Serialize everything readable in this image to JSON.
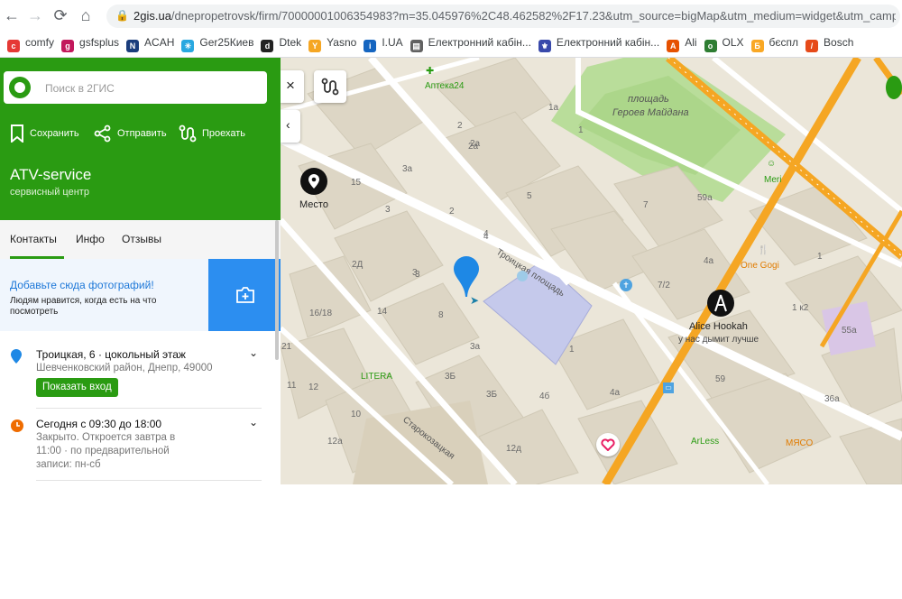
{
  "browser": {
    "url_host": "2gis.ua",
    "url_path": "/dnepropetrovsk/firm/70000001006354983?m=35.045976%2C48.462582%2F17.23&utm_source=bigMap&utm_medium=widget&utm_camp",
    "bookmarks": [
      {
        "label": "comfy",
        "color": "#e53935",
        "glyph": "c"
      },
      {
        "label": "gsfsplus",
        "color": "#c2185b",
        "glyph": "g"
      },
      {
        "label": "ACAH",
        "color": "#1a3d7c",
        "glyph": "N"
      },
      {
        "label": "Ger25Киев",
        "color": "#29a8e0",
        "glyph": "✳"
      },
      {
        "label": "Dtek",
        "color": "#222222",
        "glyph": "d"
      },
      {
        "label": "Yasno",
        "color": "#f5a623",
        "glyph": "Y"
      },
      {
        "label": "I.UA",
        "color": "#1565c0",
        "glyph": "i"
      },
      {
        "label": "Електронний кабін...",
        "color": "#616161",
        "glyph": "▤"
      },
      {
        "label": "Електронний кабін...",
        "color": "#3949ab",
        "glyph": "⚜"
      },
      {
        "label": "Ali",
        "color": "#e65100",
        "glyph": "A"
      },
      {
        "label": "OLX",
        "color": "#2e7d32",
        "glyph": "o"
      },
      {
        "label": "бєспл",
        "color": "#f9a825",
        "glyph": "Б"
      },
      {
        "label": "Bosch",
        "color": "#e64a19",
        "glyph": "/"
      }
    ]
  },
  "panel": {
    "search_placeholder": "Поиск в 2ГИС",
    "actions": {
      "save": "Сохранить",
      "share": "Отправить",
      "route": "Проехать"
    },
    "firm_name": "ATV-service",
    "firm_category": "сервисный центр",
    "tabs": [
      "Контакты",
      "Инфо",
      "Отзывы"
    ],
    "photo_title": "Добавьте сюда фотографий!",
    "photo_text": "Людям нравится, когда есть на что посмотреть",
    "address_main": "Троицкая, 6 · цокольный этаж",
    "address_sub": "Шевченковский район, Днепр, 49000",
    "show_entrance": "Показать вход",
    "hours_main": "Сегодня с 09:30 до 18:00",
    "hours_sub_1": "Закрыто. Откроется завтра в",
    "hours_sub_2": "11:00 · по предварительной",
    "hours_sub_3": "записи: пн-сб"
  },
  "map": {
    "labels": {
      "apteka": "Аптека24",
      "square": "площадь",
      "square2": "Героев Майдана",
      "mesto": "Место",
      "troitskaya": "Троицкая площадь",
      "starokazatskaya": "Старокозацкая",
      "meri": "Meri",
      "onegogi": "One Gogi",
      "alice": "Alice Hookah",
      "alice_sub": "у нас дымит лучше",
      "litera": "LITERA",
      "arless": "ArLess",
      "myaso": "МЯСО"
    },
    "houses": [
      "2",
      "1a",
      "2a",
      "1",
      "2a",
      "3a",
      "15",
      "3",
      "2",
      "3",
      "4",
      "2Д",
      "3",
      "8",
      "14",
      "16/18",
      "21",
      "1",
      "3Б",
      "3a",
      "3Б",
      "4б",
      "4a",
      "7",
      "5",
      "59a",
      "4a",
      "1",
      "7/2",
      "1 к2",
      "55a",
      "59",
      "36a",
      "12",
      "12д",
      "10",
      "12a",
      "11",
      "4"
    ]
  }
}
